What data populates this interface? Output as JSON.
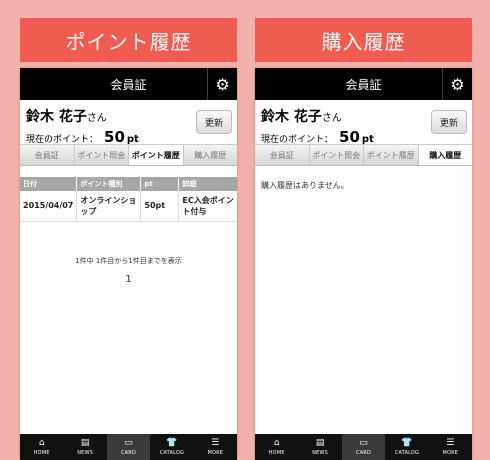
{
  "left": {
    "banner": "ポイント履歴",
    "header_title": "会員証",
    "user_name": "鈴木 花子",
    "honorific": "さん",
    "points_label": "現在のポイント：",
    "points_value": "50",
    "points_unit": "pt",
    "refresh_label": "更新",
    "tabs": [
      "会員証",
      "ポイント照会",
      "ポイント履歴",
      "購入履歴"
    ],
    "active_tab": 2,
    "table": {
      "headers": [
        "日付",
        "ポイント種別",
        "pt",
        "詳細"
      ],
      "rows": [
        [
          "2015/04/07",
          "オンラインショップ",
          "50pt",
          "EC入会ポイント付与"
        ]
      ]
    },
    "count_text": "1件中 1件目から1件目までを表示",
    "page_number": "1"
  },
  "right": {
    "banner": "購入履歴",
    "header_title": "会員証",
    "user_name": "鈴木 花子",
    "honorific": "さん",
    "points_label": "現在のポイント：",
    "points_value": "50",
    "points_unit": "pt",
    "refresh_label": "更新",
    "tabs": [
      "会員証",
      "ポイント照会",
      "ポイント履歴",
      "購入履歴"
    ],
    "active_tab": 3,
    "empty_message": "購入履歴はありません。"
  },
  "nav": [
    {
      "icon": "home-icon",
      "glyph": "⌂",
      "label": "HOME"
    },
    {
      "icon": "news-icon",
      "glyph": "▤",
      "label": "NEWS"
    },
    {
      "icon": "card-icon",
      "glyph": "▭",
      "label": "CARD"
    },
    {
      "icon": "catalog-icon",
      "glyph": "👕",
      "label": "CATALOG"
    },
    {
      "icon": "more-icon",
      "glyph": "☰",
      "label": "MORE"
    }
  ],
  "active_nav": 2,
  "colors": {
    "background": "#f2b1ab",
    "banner": "#f05c50",
    "header": "#000000"
  }
}
